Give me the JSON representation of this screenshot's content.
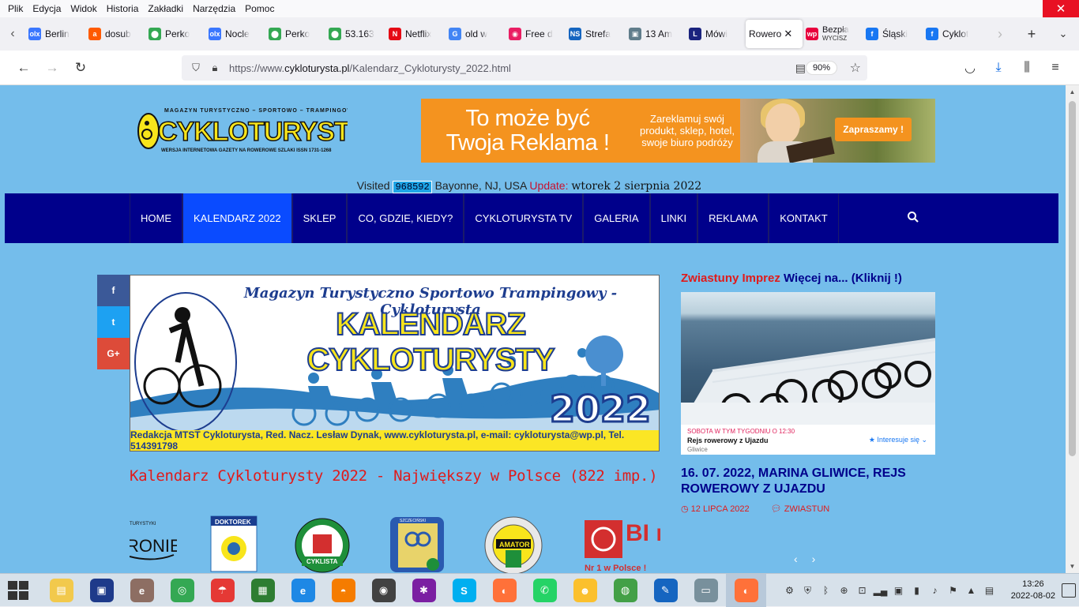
{
  "menu": [
    "Plik",
    "Edycja",
    "Widok",
    "Historia",
    "Zakładki",
    "Narzędzia",
    "Pomoc"
  ],
  "tabs": [
    {
      "label": "Berlin",
      "icon": "olx-icon",
      "color": "#3a77ff",
      "glyph": "olx"
    },
    {
      "label": "dosub",
      "icon": "allegro-icon",
      "color": "#ff5a00",
      "glyph": "a"
    },
    {
      "label": "Perko",
      "icon": "maps-pin-icon",
      "color": "#34a853",
      "glyph": "⬤"
    },
    {
      "label": "Nocle",
      "icon": "olx-icon",
      "color": "#3a77ff",
      "glyph": "olx"
    },
    {
      "label": "Perko",
      "icon": "maps-pin-icon",
      "color": "#34a853",
      "glyph": "⬤"
    },
    {
      "label": "53.163",
      "icon": "maps-pin-icon",
      "color": "#34a853",
      "glyph": "⬤"
    },
    {
      "label": "Netflix",
      "icon": "netflix-icon",
      "color": "#e50914",
      "glyph": "N"
    },
    {
      "label": "old w",
      "icon": "google-icon",
      "color": "#4285f4",
      "glyph": "G"
    },
    {
      "label": "Free d",
      "icon": "pink-app-icon",
      "color": "#e91e63",
      "glyph": "◉"
    },
    {
      "label": "Strefa",
      "icon": "ns-icon",
      "color": "#1565c0",
      "glyph": "NS"
    },
    {
      "label": "13 Am",
      "icon": "page-icon",
      "color": "#607d8b",
      "glyph": "▣"
    },
    {
      "label": "Mówi",
      "icon": "l-logo-icon",
      "color": "#1a237e",
      "glyph": "L"
    },
    {
      "label": "Rowero",
      "icon": "",
      "color": "",
      "glyph": "",
      "active": true
    },
    {
      "label": "Bezpła",
      "sub": "WYCISZ",
      "icon": "wp-icon",
      "color": "#e8003d",
      "glyph": "wp"
    },
    {
      "label": "Śląski",
      "icon": "facebook-icon",
      "color": "#1877f2",
      "glyph": "f"
    },
    {
      "label": "Cyklot",
      "icon": "facebook-icon",
      "color": "#1877f2",
      "glyph": "f"
    }
  ],
  "url": {
    "prefix": "https://www.",
    "domain": "cykloturysta.pl",
    "path": "/Kalendarz_Cykloturysty_2022.html"
  },
  "zoom": "90%",
  "ad": {
    "line1": "To może być",
    "line2": "Twoja Reklama !",
    "blurb": "Zareklamuj swój produkt, sklep, hotel, swoje biuro podróży",
    "cta": "Zapraszamy !"
  },
  "visited": {
    "label": "Visited",
    "counter": "968592",
    "location": "Bayonne, NJ, USA",
    "update_label": "Update:",
    "date": "wtorek 2 sierpnia 2022"
  },
  "nav": [
    {
      "label": "HOME"
    },
    {
      "label": "KALENDARZ 2022",
      "active": true
    },
    {
      "label": "SKLEP"
    },
    {
      "label": "CO, GDZIE, KIEDY?"
    },
    {
      "label": "CYKLOTURYSTA TV"
    },
    {
      "label": "GALERIA"
    },
    {
      "label": "LINKI"
    },
    {
      "label": "REKLAMA"
    },
    {
      "label": "KONTAKT"
    }
  ],
  "share": {
    "fb": "f",
    "tw": "t",
    "gp": "G+"
  },
  "banner": {
    "top": "Magazyn Turystyczno Sportowo Trampingowy - Cykloturysta",
    "big": "KALENDARZ CYKLOTURYSTY",
    "year": "2022",
    "footer": "Redakcja MTST Cykloturysta, Red. Nacz. Lesław Dynak, www.cykloturysta.pl, e-mail: cykloturysta@wp.pl, Tel. 514391798"
  },
  "page_title": "Kalendarz Cykloturysty 2022 - Największy w Polsce (822 imp.)",
  "logos": [
    "RONIE",
    "DOKTOREK",
    "CYKLISTA",
    "SZCZECIŃSKI",
    "AMATOR",
    "BI ma",
    "Nr 1 w Polsce !"
  ],
  "sidebar": {
    "head_red": "Zwiastuny Imprez",
    "head_blue": "Więcej na... (Kliknij !)",
    "event_kicker": "SOBOTA W TYM TYGODNIU O 12:30",
    "event_title": "Rejs rowerowy z Ujazdu",
    "event_place": "Gliwice",
    "event_button": "Interesuje się",
    "article_title": "16. 07. 2022, MARINA GLIWICE, REJS ROWEROWY Z UJAZDU",
    "article_date": "12 LIPCA 2022",
    "article_tag": "ZWIASTUN",
    "prev": "‹",
    "next": "›"
  },
  "taskbar": {
    "icons": [
      {
        "name": "file-explorer-icon",
        "color": "#f2c94c",
        "glyph": "▤"
      },
      {
        "name": "save-disk-icon",
        "color": "#1e3a8a",
        "glyph": "▣"
      },
      {
        "name": "ie-app-icon",
        "color": "#8d6e63",
        "glyph": "e"
      },
      {
        "name": "chrome-icon",
        "color": "#34a853",
        "glyph": "◎"
      },
      {
        "name": "umbrella-app-icon",
        "color": "#e53935",
        "glyph": "☂"
      },
      {
        "name": "calculator-icon",
        "color": "#2e7d32",
        "glyph": "▦"
      },
      {
        "name": "internet-explorer-icon",
        "color": "#1e88e5",
        "glyph": "e"
      },
      {
        "name": "balloon-app-icon",
        "color": "#f57c00",
        "glyph": "◓"
      },
      {
        "name": "eye-app-icon",
        "color": "#424242",
        "glyph": "◉"
      },
      {
        "name": "puzzle-app-icon",
        "color": "#7b1fa2",
        "glyph": "✱"
      },
      {
        "name": "skype-icon",
        "color": "#00aff0",
        "glyph": "S"
      },
      {
        "name": "firefox-icon",
        "color": "#ff7139",
        "glyph": "◐"
      },
      {
        "name": "whatsapp-icon",
        "color": "#25d366",
        "glyph": "✆"
      },
      {
        "name": "chat-app-icon",
        "color": "#fbc02d",
        "glyph": "☻"
      },
      {
        "name": "network-app-icon",
        "color": "#43a047",
        "glyph": "◍"
      },
      {
        "name": "editor-app-icon",
        "color": "#1565c0",
        "glyph": "✎"
      },
      {
        "name": "notes-app-icon",
        "color": "#78909c",
        "glyph": "▭"
      },
      {
        "name": "firefox-active-icon",
        "color": "#ff7139",
        "glyph": "◐",
        "selected": true
      }
    ],
    "time": "13:26",
    "date": "2022-08-02"
  }
}
